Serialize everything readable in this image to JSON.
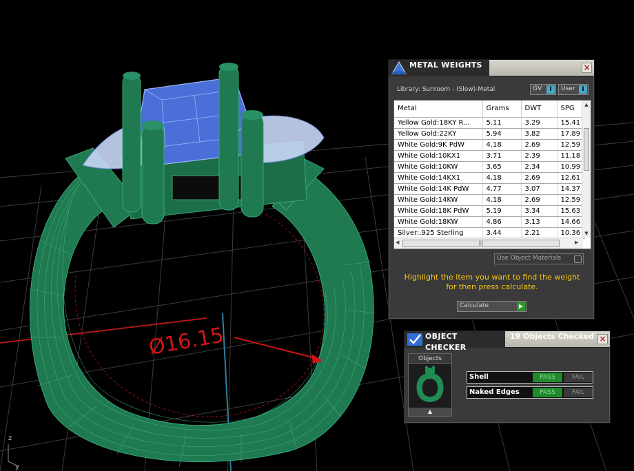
{
  "viewport": {
    "dimension_label": "Ø16.15",
    "axis_z": "z",
    "axis_y": "y"
  },
  "metal_weights": {
    "title": "METAL WEIGHTS",
    "library": "Library: Sunroom - (Slow)-Metal",
    "gv_label": "GV",
    "user_label": "User",
    "columns": [
      "Metal",
      "Grams",
      "DWT",
      "SPG"
    ],
    "rows": [
      [
        "Yellow Gold:18KY R...",
        "5.11",
        "3.29",
        "15.41"
      ],
      [
        "Yellow Gold:22KY",
        "5.94",
        "3.82",
        "17.89"
      ],
      [
        "White Gold:9K PdW",
        "4.18",
        "2.69",
        "12.59"
      ],
      [
        "White Gold:10KX1",
        "3.71",
        "2.39",
        "11.18"
      ],
      [
        "White Gold:10KW",
        "3.65",
        "2.34",
        "10.99"
      ],
      [
        "White Gold:14KX1",
        "4.18",
        "2.69",
        "12.61"
      ],
      [
        "White Gold:14K PdW",
        "4.77",
        "3.07",
        "14.37"
      ],
      [
        "White Gold:14KW",
        "4.18",
        "2.69",
        "12.59"
      ],
      [
        "White Gold:18K PdW",
        "5.19",
        "3.34",
        "15.63"
      ],
      [
        "White Gold:18KW",
        "4.86",
        "3.13",
        "14.66"
      ],
      [
        "Silver:.925 Sterling",
        "3.44",
        "2.21",
        "10.36"
      ]
    ],
    "use_object_materials": "Use Object Materials",
    "hint_line1": "Highlight the item you want to find the weight",
    "hint_line2": "for then press calculate.",
    "calculate_label": "Calculate"
  },
  "object_checker": {
    "title": "OBJECT CHECKER",
    "status": "19  Objects Checked",
    "objects_label": "Objects",
    "checks": [
      {
        "label": "Shell",
        "pass": "PASS",
        "fail": "FAIL"
      },
      {
        "label": "Naked Edges",
        "pass": "PASS",
        "fail": "FAIL"
      }
    ]
  },
  "colors": {
    "ring_green": "#1f7a52",
    "gem_blue": "#4a6fd8",
    "grid_gray": "#3c3c3c",
    "dimension_red": "#d01515",
    "hint_yellow": "#f5c518",
    "pass_green": "#1f8b2c"
  }
}
